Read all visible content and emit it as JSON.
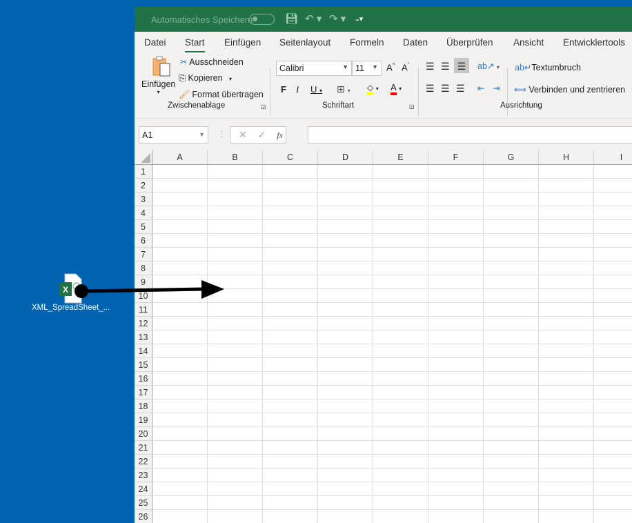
{
  "desktop": {
    "file_label": "XML_SpreadSheet_..."
  },
  "titlebar": {
    "autosave_label": "Automatisches Speichern",
    "save_icon": "save-icon",
    "undo_icon": "undo-icon",
    "redo_icon": "redo-icon",
    "customize_icon": "customize-qat-icon"
  },
  "tabs": [
    {
      "label": "Datei"
    },
    {
      "label": "Start",
      "active": true
    },
    {
      "label": "Einfügen"
    },
    {
      "label": "Seitenlayout"
    },
    {
      "label": "Formeln"
    },
    {
      "label": "Daten"
    },
    {
      "label": "Überprüfen"
    },
    {
      "label": "Ansicht"
    },
    {
      "label": "Entwicklertools"
    }
  ],
  "clipboard": {
    "paste": "Einfügen",
    "cut": "Ausschneiden",
    "copy": "Kopieren",
    "format_painter": "Format übertragen",
    "group": "Zwischenablage"
  },
  "font": {
    "name": "Calibri",
    "size": "11",
    "bold": "F",
    "italic": "I",
    "underline": "U",
    "group": "Schriftart",
    "highlight_color": "#ffff00",
    "font_color": "#ff0000"
  },
  "alignment": {
    "wrap": "Textumbruch",
    "merge": "Verbinden und zentrieren",
    "group": "Ausrichtung"
  },
  "formula_bar": {
    "name_box": "A1",
    "fx": "fx",
    "value": ""
  },
  "columns": [
    "A",
    "B",
    "C",
    "D",
    "E",
    "F",
    "G",
    "H",
    "I"
  ],
  "rows": [
    "1",
    "2",
    "3",
    "4",
    "5",
    "6",
    "7",
    "8",
    "9",
    "10",
    "11",
    "12",
    "13",
    "14",
    "15",
    "16",
    "17",
    "18",
    "19",
    "20",
    "21",
    "22",
    "23",
    "24",
    "25",
    "26"
  ],
  "colors": {
    "title_bar": "#217346",
    "desktop": "#0063b1"
  }
}
